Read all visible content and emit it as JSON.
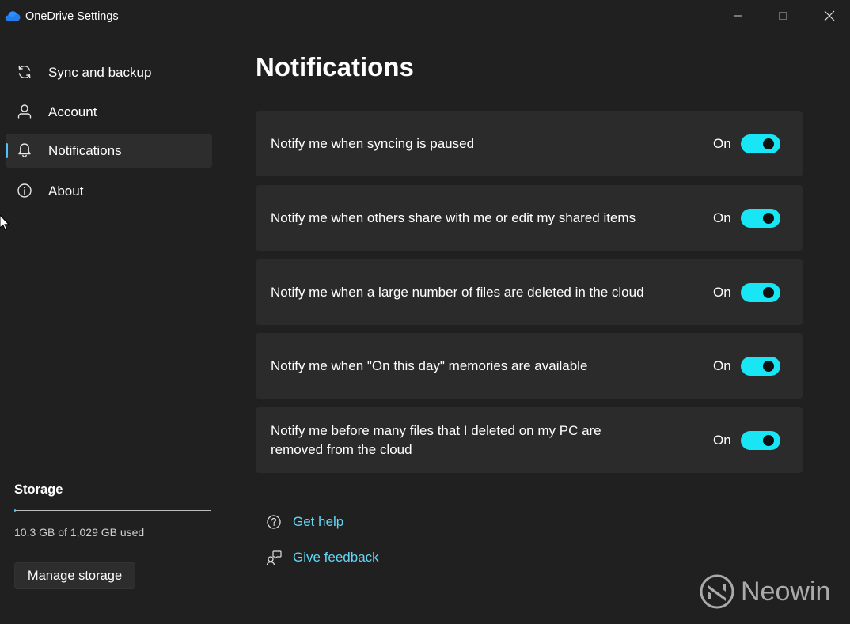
{
  "window": {
    "title": "OneDrive Settings",
    "app_icon": "onedrive-cloud-icon",
    "controls": [
      "minimize-icon",
      "maximize-icon",
      "close-icon"
    ]
  },
  "sidebar": {
    "items": [
      {
        "label": "Sync and backup",
        "icon": "sync-icon",
        "active": false
      },
      {
        "label": "Account",
        "icon": "person-icon",
        "active": false
      },
      {
        "label": "Notifications",
        "icon": "bell-icon",
        "active": true
      },
      {
        "label": "About",
        "icon": "info-icon",
        "active": false
      }
    ],
    "storage": {
      "title": "Storage",
      "used_text": "10.3 GB of 1,029 GB used",
      "used_fraction": 0.01,
      "manage_label": "Manage storage"
    }
  },
  "main": {
    "title": "Notifications",
    "settings": [
      {
        "label": "Notify me when syncing is paused",
        "state": "On",
        "enabled": true
      },
      {
        "label": "Notify me when others share with me or edit my shared items",
        "state": "On",
        "enabled": true
      },
      {
        "label": "Notify me when a large number of files are deleted in the cloud",
        "state": "On",
        "enabled": true
      },
      {
        "label": "Notify me when \"On this day\" memories are available",
        "state": "On",
        "enabled": true
      },
      {
        "label": "Notify me before many files that I deleted on my PC are removed from the cloud",
        "state": "On",
        "enabled": true
      }
    ],
    "links": [
      {
        "label": "Get help",
        "icon": "help-icon"
      },
      {
        "label": "Give feedback",
        "icon": "feedback-icon"
      }
    ]
  },
  "watermark": {
    "text": "Neowin"
  },
  "colors": {
    "background": "#202020",
    "card": "#2b2b2b",
    "accent": "#4cc2ff",
    "toggle_on": "#19e6f5",
    "link": "#64d6f5"
  }
}
